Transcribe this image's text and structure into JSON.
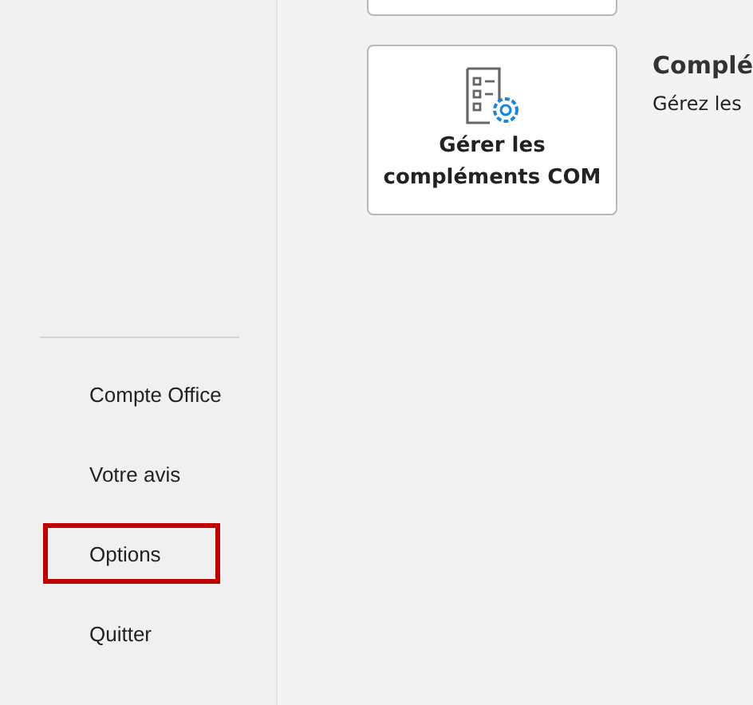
{
  "sidebar": {
    "items": [
      {
        "label": "Compte Office",
        "highlighted": false
      },
      {
        "label": "Votre avis",
        "highlighted": false
      },
      {
        "label": "Options",
        "highlighted": true
      },
      {
        "label": "Quitter",
        "highlighted": false
      }
    ]
  },
  "content": {
    "tiles": [
      {
        "kind": "empty"
      },
      {
        "kind": "com",
        "label": "Gérer les compléments COM",
        "title": "Complé",
        "description": "Gérez les"
      }
    ]
  }
}
